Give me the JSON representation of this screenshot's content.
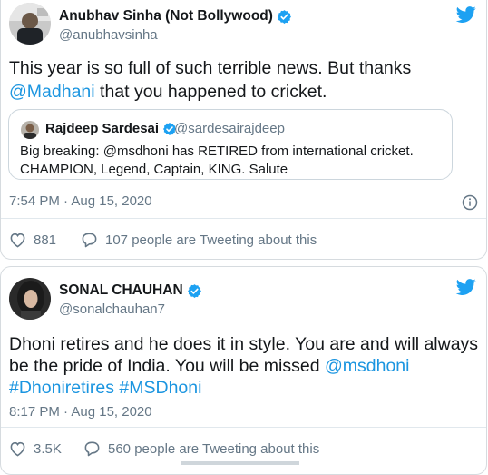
{
  "tweet1": {
    "name": "Anubhav Sinha (Not Bollywood)",
    "handle": "@anubhavsinha",
    "text_line1": "This year is so full of such terrible news. But thanks",
    "mention": "@Madhani",
    "text_line2_rest": " that you happened to cricket.",
    "quote": {
      "name": "Rajdeep Sardesai",
      "handle": "@sardesairajdeep",
      "line1": "Big breaking: @msdhoni has RETIRED from international cricket.",
      "line2": "CHAMPION, Legend, Captain, KING. Salute"
    },
    "timestamp": "7:54 PM · Aug 15, 2020",
    "likes": "881",
    "conversation": "107 people are Tweeting about this"
  },
  "tweet2": {
    "name": "SONAL CHAUHAN",
    "handle": "@sonalchauhan7",
    "line1": "Dhoni retires and he does it in style.  You are and will always",
    "line2_plain": "be the pride of India. You will be missed ",
    "mention": "@msdhoni",
    "hashtag1": "#Dhoniretires",
    "hashtag2": "#MSDhoni",
    "timestamp": "8:17 PM · Aug 15, 2020",
    "likes": "3.5K",
    "conversation": "560 people are Tweeting about this"
  },
  "colors": {
    "link": "#1b95e0",
    "muted": "#657786",
    "verified": "#1da1f2",
    "border": "#d6dbdf"
  },
  "icons": [
    "twitter-bird-icon",
    "verified-badge-icon",
    "heart-icon",
    "speech-bubble-icon",
    "info-icon"
  ]
}
